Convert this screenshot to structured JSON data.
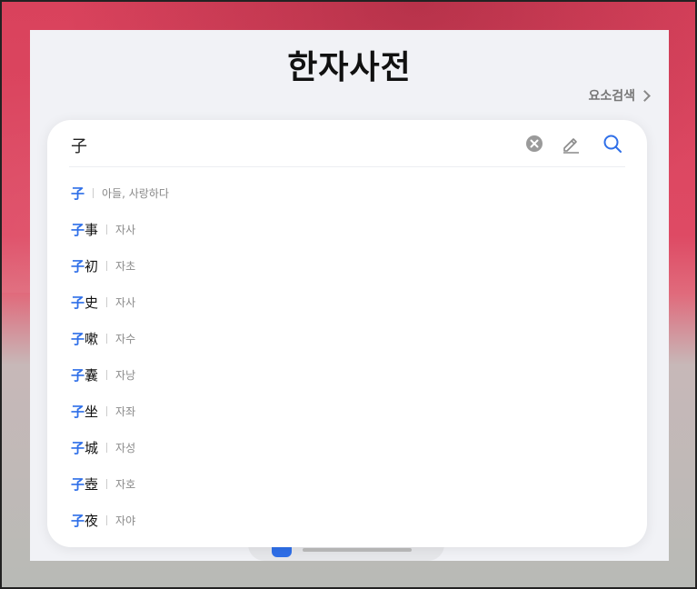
{
  "page": {
    "title": "한자사전",
    "element_search_label": "요소검색"
  },
  "search": {
    "value": "子",
    "clear_icon": "clear-circle-icon",
    "handwrite_icon": "pencil-icon",
    "search_icon": "magnifier-icon"
  },
  "colors": {
    "accent": "#2f6fe8",
    "reading": "#8a8a8a"
  },
  "results": [
    {
      "highlight": "子",
      "rest": "",
      "reading": "아들, 사랑하다"
    },
    {
      "highlight": "子",
      "rest": "事",
      "reading": "자사"
    },
    {
      "highlight": "子",
      "rest": "初",
      "reading": "자초"
    },
    {
      "highlight": "子",
      "rest": "史",
      "reading": "자사"
    },
    {
      "highlight": "子",
      "rest": "嗽",
      "reading": "자수"
    },
    {
      "highlight": "子",
      "rest": "囊",
      "reading": "자낭"
    },
    {
      "highlight": "子",
      "rest": "坐",
      "reading": "자좌"
    },
    {
      "highlight": "子",
      "rest": "城",
      "reading": "자성"
    },
    {
      "highlight": "子",
      "rest": "壺",
      "reading": "자호"
    },
    {
      "highlight": "子",
      "rest": "夜",
      "reading": "자야"
    }
  ]
}
